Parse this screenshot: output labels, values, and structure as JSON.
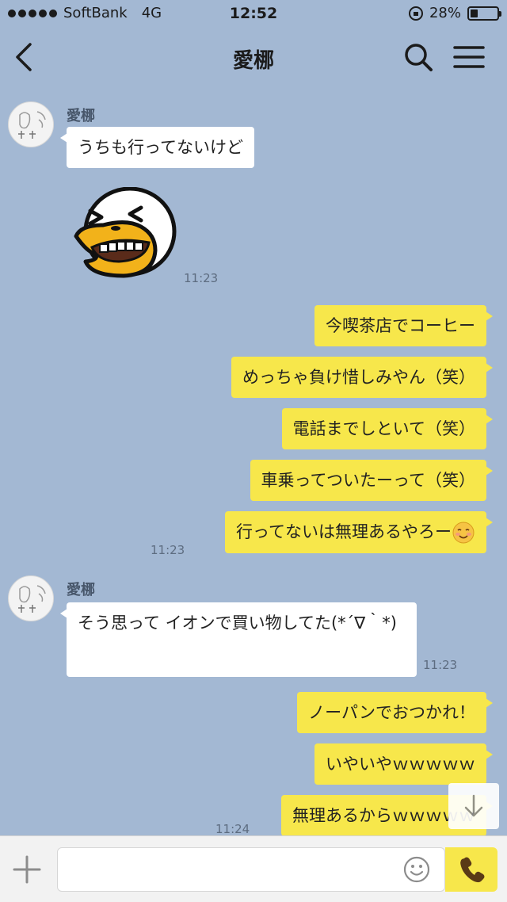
{
  "status_bar": {
    "carrier": "SoftBank",
    "network": "4G",
    "time": "12:52",
    "battery": "28%",
    "battery_level": 0.28
  },
  "header": {
    "title": "愛梛"
  },
  "messages": [
    {
      "sender": "愛梛",
      "text": "うちも行ってないけど"
    },
    {
      "time": "11:23"
    },
    {
      "text": "今喫茶店でコーヒー"
    },
    {
      "text": "めっちゃ負け惜しみやん（笑）"
    },
    {
      "text": "電話までしといて（笑）"
    },
    {
      "text": "車乗ってついたーって（笑）"
    },
    {
      "text": "行ってないは無理あるやろー",
      "time": "11:23"
    },
    {
      "sender": "愛梛",
      "text": "そう思って イオンで買い物してた(*´∇｀*)",
      "time": "11:23"
    },
    {
      "text": "ノーパンでおつかれ！"
    },
    {
      "text": "いやいやｗｗｗｗｗ"
    },
    {
      "text": "無理あるからｗｗｗｗｗ",
      "time": "11:24"
    }
  ],
  "input": {
    "value": "",
    "placeholder": ""
  },
  "colors": {
    "background": "#a3b8d3",
    "outgoing_bubble": "#f7e74b",
    "incoming_bubble": "#ffffff"
  }
}
